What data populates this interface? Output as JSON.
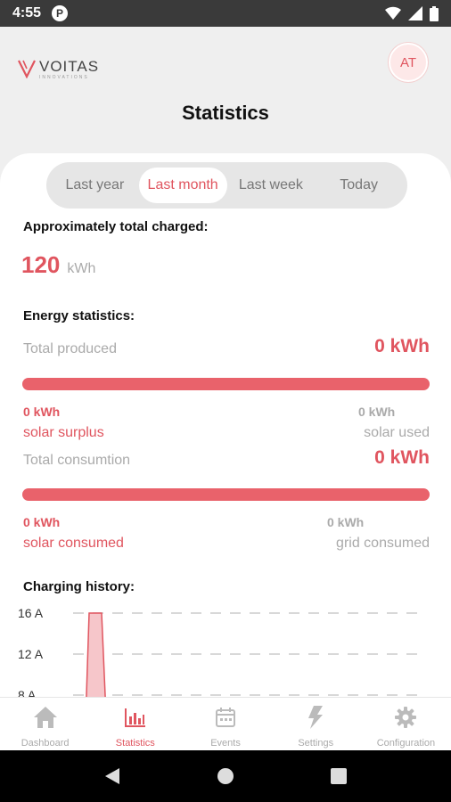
{
  "status_bar": {
    "time": "4:55",
    "app_icon_letter": "P"
  },
  "header": {
    "logo": {
      "name": "VOITAS",
      "sub": "INNOVATIONS"
    },
    "avatar_initials": "AT",
    "title": "Statistics"
  },
  "period_tabs": [
    {
      "label": "Last year",
      "active": false
    },
    {
      "label": "Last month",
      "active": true
    },
    {
      "label": "Last week",
      "active": false
    },
    {
      "label": "Today",
      "active": false
    }
  ],
  "total_charged": {
    "label": "Approximately total charged:",
    "value": "120",
    "unit": "kWh"
  },
  "energy": {
    "label": "Energy statistics:",
    "produced": {
      "label": "Total produced",
      "value": "0 kWh",
      "left_value": "0 kWh",
      "left_label": "solar surplus",
      "right_value": "0 kWh",
      "right_label": "solar used"
    },
    "consumption": {
      "label": "Total consumtion",
      "value": "0 kWh",
      "left_value": "0 kWh",
      "left_label": "solar consumed",
      "right_value": "0 kWh",
      "right_label": "grid consumed"
    }
  },
  "charging_history": {
    "label": "Charging history:",
    "y_ticks": [
      "16 A",
      "12 A",
      "8 A"
    ]
  },
  "chart_data": {
    "type": "area",
    "title": "Charging history:",
    "y_ticks": [
      16,
      12,
      8
    ],
    "ylim": [
      0,
      17
    ],
    "series": [
      {
        "values": [
          0,
          16,
          16,
          0
        ]
      }
    ]
  },
  "bottom_nav": [
    {
      "label": "Dashboard",
      "icon": "home-icon",
      "active": false
    },
    {
      "label": "Statistics",
      "icon": "bar-chart-icon",
      "active": true
    },
    {
      "label": "Events",
      "icon": "calendar-icon",
      "active": false
    },
    {
      "label": "Settings",
      "icon": "lightning-icon",
      "active": false
    },
    {
      "label": "Configuration",
      "icon": "gear-icon",
      "active": false
    }
  ],
  "colors": {
    "accent": "#e0555f",
    "bar": "#e9626b",
    "muted": "#aaaaaa"
  }
}
